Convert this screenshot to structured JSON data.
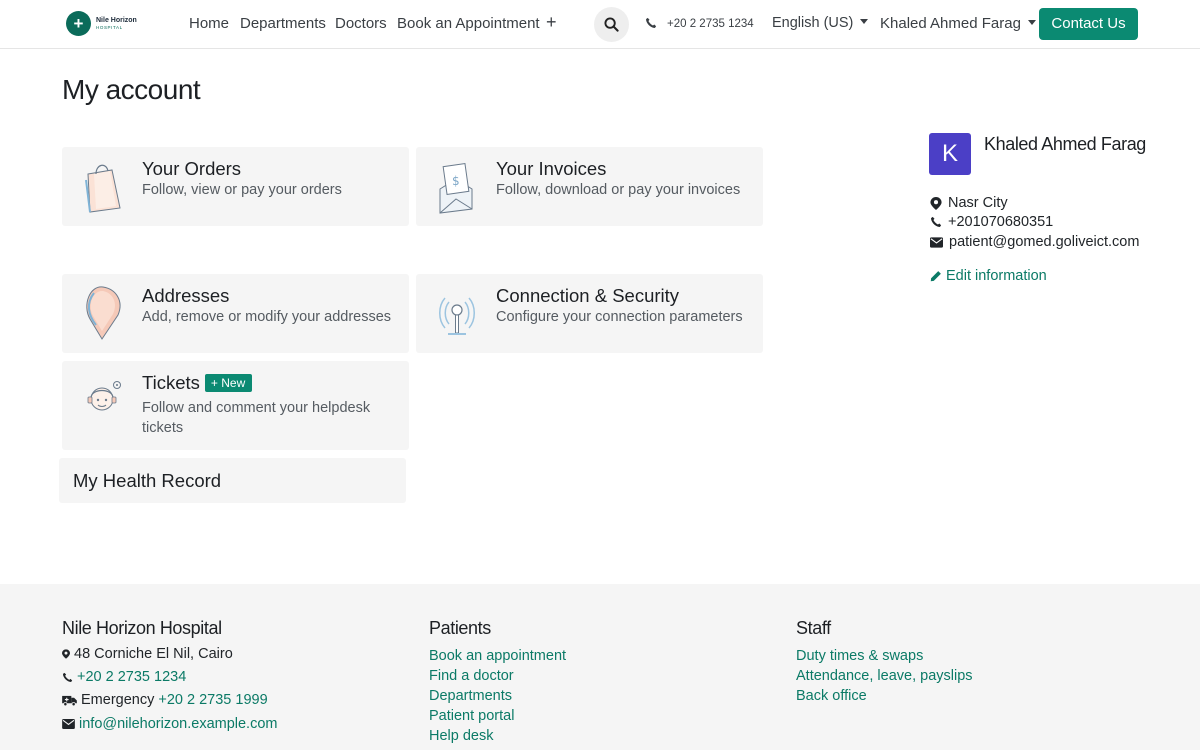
{
  "header": {
    "logo_line1": "Nile Horizon",
    "logo_line2": "HOSPITAL",
    "nav": [
      "Home",
      "Departments",
      "Doctors",
      "Book an Appointment"
    ],
    "phone": "+20 2 2735 1234",
    "language": "English (US)",
    "user": "Khaled Ahmed Farag",
    "contact_label": "Contact Us"
  },
  "main": {
    "title": "My account",
    "cards": [
      {
        "title": "Your Orders",
        "desc": "Follow, view or pay your orders"
      },
      {
        "title": "Your Invoices",
        "desc": "Follow, download or pay your invoices"
      },
      {
        "title": "Addresses",
        "desc": "Add, remove or modify your addresses"
      },
      {
        "title": "Connection & Security",
        "desc": "Configure your connection parameters"
      },
      {
        "title": "Tickets",
        "desc": "Follow and comment your helpdesk tickets",
        "badge": "New"
      }
    ],
    "health_record": "My Health Record"
  },
  "sidebar": {
    "avatar_letter": "K",
    "name": "Khaled Ahmed Farag",
    "city": "Nasr City",
    "phone": "+201070680351",
    "email": "patient@gomed.goliveict.com",
    "edit_label": "Edit information"
  },
  "footer": {
    "col1": {
      "title": "Nile Horizon Hospital",
      "address": "48 Corniche El Nil, Cairo",
      "phone": "+20 2 2735 1234",
      "emergency_label": "Emergency",
      "emergency_phone": "+20 2 2735 1999",
      "email": "info@nilehorizon.example.com"
    },
    "col2": {
      "title": "Patients",
      "links": [
        "Book an appointment",
        "Find a doctor",
        "Departments",
        "Patient portal",
        "Help desk"
      ]
    },
    "col3": {
      "title": "Staff",
      "links": [
        "Duty times & swaps",
        "Attendance, leave, payslips",
        "Back office"
      ]
    }
  },
  "colors": {
    "brand": "#0b8a72",
    "link": "#0b7a66",
    "avatar": "#4b3fc6",
    "card_bg": "#f5f5f5"
  }
}
